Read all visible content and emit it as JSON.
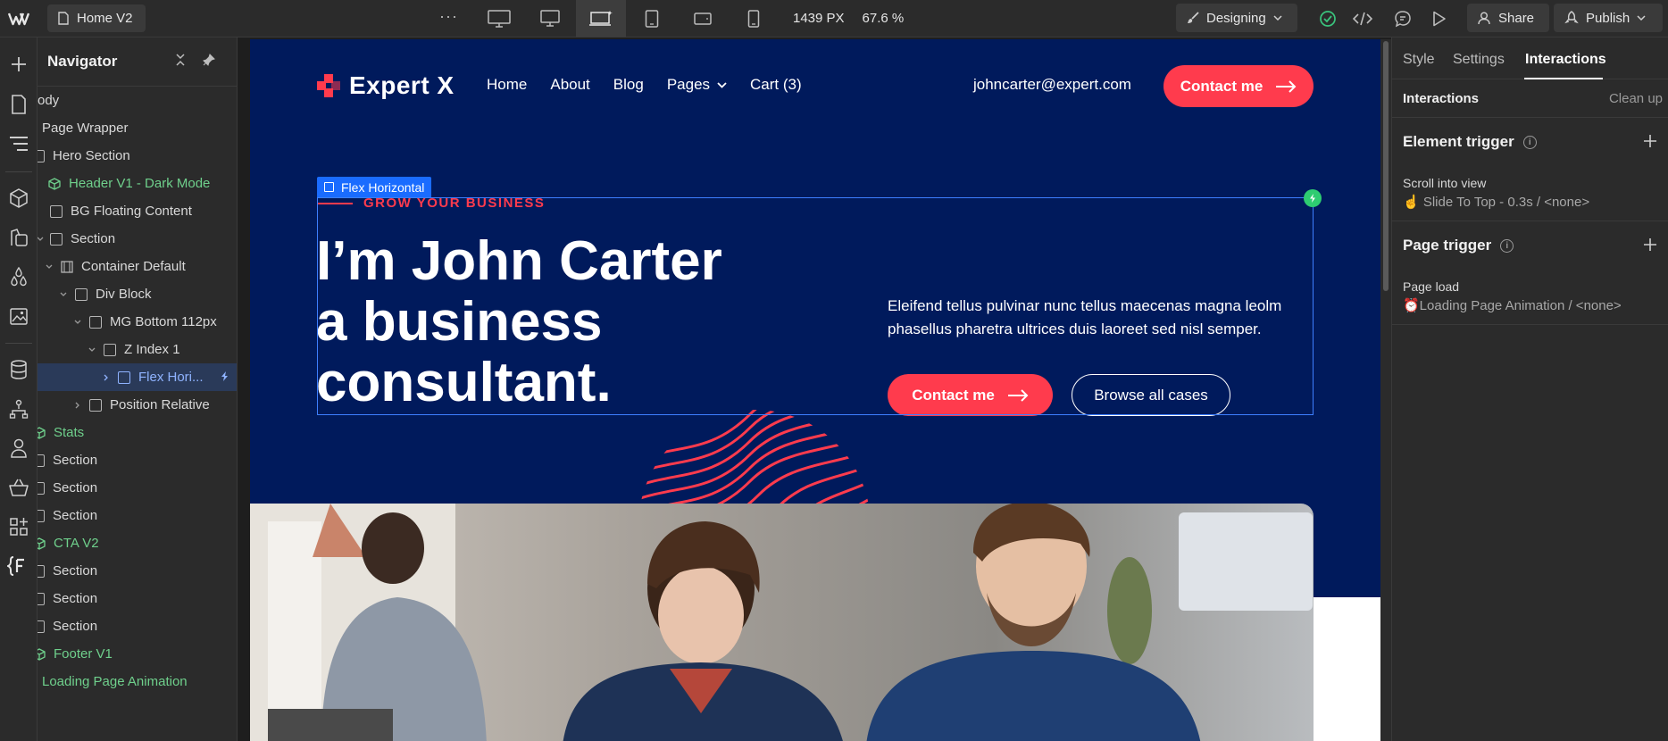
{
  "topbar": {
    "page_name": "Home V2",
    "more": "···",
    "width": "1439 PX",
    "zoom": "67.6 %",
    "mode": "Designing",
    "share": "Share",
    "publish": "Publish"
  },
  "navigator": {
    "title": "Navigator",
    "items": [
      {
        "label": "ody"
      },
      {
        "label": "Page Wrapper"
      },
      {
        "label": "Hero Section"
      },
      {
        "label": "Header V1 - Dark Mode"
      },
      {
        "label": "BG Floating Content"
      },
      {
        "label": "Section"
      },
      {
        "label": "Container Default"
      },
      {
        "label": "Div Block"
      },
      {
        "label": "MG Bottom 112px"
      },
      {
        "label": "Z Index 1"
      },
      {
        "label": "Flex Hori..."
      },
      {
        "label": "Position Relative"
      },
      {
        "label": "Stats"
      },
      {
        "label": "Section"
      },
      {
        "label": "Section"
      },
      {
        "label": "Section"
      },
      {
        "label": "CTA V2"
      },
      {
        "label": "Section"
      },
      {
        "label": "Section"
      },
      {
        "label": "Section"
      },
      {
        "label": "Footer V1"
      },
      {
        "label": "Loading Page Animation"
      }
    ]
  },
  "site": {
    "logo": "Expert X",
    "nav": [
      "Home",
      "About",
      "Blog",
      "Pages",
      "Cart (3)"
    ],
    "email": "johncarter@expert.com",
    "cta": "Contact me",
    "eyebrow": "GROW YOUR BUSINESS",
    "heading_lines": [
      "I’m John Carter",
      "a business",
      "consultant."
    ],
    "paragraph": "Eleifend tellus pulvinar nunc tellus maecenas magna leolm phasellus pharetra ultrices duis laoreet sed nisl semper.",
    "cta2": "Contact me",
    "secondary": "Browse all cases",
    "selected_label": "Flex Horizontal"
  },
  "panel": {
    "tabs": [
      "Style",
      "Settings",
      "Interactions"
    ],
    "active_tab": "Interactions",
    "header": "Interactions",
    "clean_up": "Clean up",
    "element_trigger": {
      "title": "Element trigger",
      "event": "Scroll into view",
      "action": "☝️ Slide To Top - 0.3s / <none>"
    },
    "page_trigger": {
      "title": "Page trigger",
      "event": "Page load",
      "action": "⏰Loading Page Animation / <none>"
    }
  },
  "colors": {
    "hero_bg": "#001a5c",
    "accent_red": "#ff3b4d",
    "selection_blue": "#1a6cff",
    "symbol_green": "#6fd08c"
  }
}
